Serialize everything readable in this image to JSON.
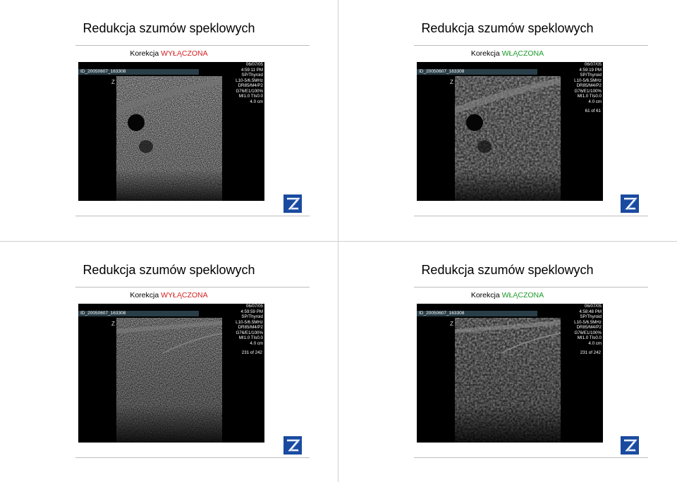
{
  "slides": [
    {
      "title": "Redukcja szumów speklowych",
      "subtitle_prefix": "Korekcja ",
      "subtitle_state": "WYŁĄCZONA",
      "image": {
        "id": "ID_20050607_163308",
        "date": "06/07/05",
        "time": "4:59:11 PM",
        "preset": "SP/Thyroid",
        "probe": "L10-5/6.5MHz",
        "dr": "DR85/M4/P2",
        "gain": "G76/E1/100%",
        "mi": "MI1.0  TIs0.0",
        "depth": "4.0 cm",
        "frame": ""
      }
    },
    {
      "title": "Redukcja szumów speklowych",
      "subtitle_prefix": "Korekcja ",
      "subtitle_state": "WŁĄCZONA",
      "image": {
        "id": "ID_20050607_163308",
        "date": "06/07/05",
        "time": "4:59:19 PM",
        "preset": "SP/Thyroid",
        "probe": "L10-5/6.5MHz",
        "dr": "DR85/M4/P2",
        "gain": "G76/E1/100%",
        "mi": "MI1.0  TIs0.0",
        "depth": "4.0 cm",
        "frame": "61 of 61"
      }
    },
    {
      "title": "Redukcja szumów speklowych",
      "subtitle_prefix": "Korekcja ",
      "subtitle_state": "WYŁĄCZONA",
      "image": {
        "id": "ID_20050607_163308",
        "date": "06/07/05",
        "time": "4:59:59 PM",
        "preset": "SP/Thyroid",
        "probe": "L10-5/6.5MHz",
        "dr": "DR85/M4/P2",
        "gain": "G76/E1/100%",
        "mi": "MI1.0  TIs0.0",
        "depth": "4.0 cm",
        "frame": "231 of 242"
      }
    },
    {
      "title": "Redukcja szumów speklowych",
      "subtitle_prefix": "Korekcja ",
      "subtitle_state": "WŁĄCZONA",
      "image": {
        "id": "ID_20050607_163308",
        "date": "06/07/05",
        "time": "4:58:48 PM",
        "preset": "SP/Thyroid",
        "probe": "L10-5/6.5MHz",
        "dr": "DR85/M4/P2",
        "gain": "G76/E1/100%",
        "mi": "MI1.0  TIs0.0",
        "depth": "4.0 cm",
        "frame": "231 of 242"
      }
    }
  ],
  "colors": {
    "state_off": "#d32020",
    "state_on": "#1c9a2a",
    "logo_blue": "#1a4aa0"
  },
  "icons": {
    "logo": "z-logo-icon"
  }
}
